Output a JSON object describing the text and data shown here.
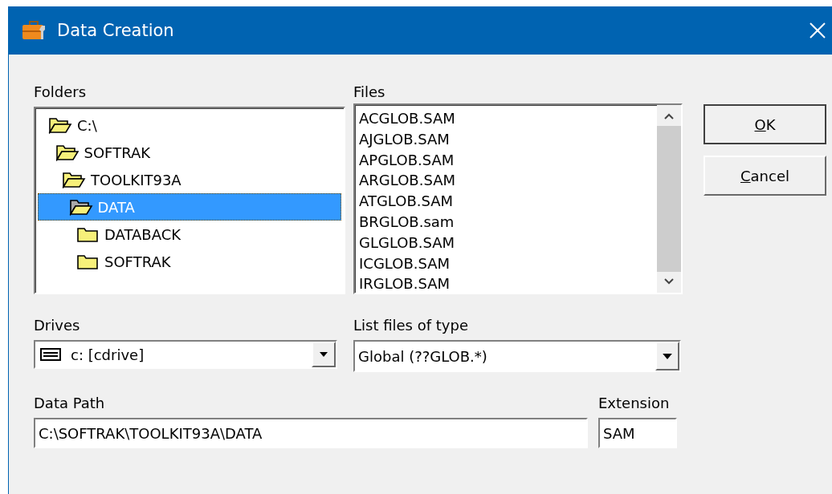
{
  "window": {
    "title": "Data Creation"
  },
  "folders": {
    "label": "Folders",
    "tree": [
      {
        "name": "C:\\",
        "open": true,
        "selected": false,
        "children": [
          {
            "name": "SOFTRAK",
            "open": true,
            "selected": false,
            "children": [
              {
                "name": "TOOLKIT93A",
                "open": true,
                "selected": false,
                "children": [
                  {
                    "name": "DATA",
                    "open": true,
                    "selected": true,
                    "children": [
                      {
                        "name": "DATABACK",
                        "open": false,
                        "selected": false
                      },
                      {
                        "name": "SOFTRAK",
                        "open": false,
                        "selected": false
                      }
                    ]
                  }
                ]
              }
            ]
          }
        ]
      }
    ]
  },
  "files": {
    "label": "Files",
    "items": [
      "ACGLOB.SAM",
      "AJGLOB.SAM",
      "APGLOB.SAM",
      "ARGLOB.SAM",
      "ATGLOB.SAM",
      "BRGLOB.sam",
      "GLGLOB.SAM",
      "ICGLOB.SAM",
      "IRGLOB.SAM"
    ]
  },
  "buttons": [
    {
      "access_key": "O",
      "rest": "K",
      "default": true
    },
    {
      "access_key": "C",
      "rest": "ancel",
      "default": false
    }
  ],
  "drives": {
    "label": "Drives",
    "value": "c: [cdrive]"
  },
  "file_type": {
    "label": "List files of type",
    "value": "Global (??GLOB.*)"
  },
  "data_path": {
    "label": "Data Path",
    "value": "C:\\SOFTRAK\\TOOLKIT93A\\DATA"
  },
  "extension": {
    "label": "Extension",
    "value": "SAM"
  }
}
